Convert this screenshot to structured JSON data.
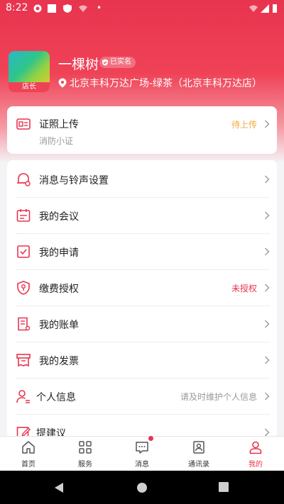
{
  "status_bar": {
    "time": "8:22"
  },
  "profile": {
    "name": "一棵树",
    "verified_label": "已实名",
    "role_badge": "店长",
    "location": "北京丰科万达广场-绿茶（北京丰科万达店）"
  },
  "certificate": {
    "title": "证照上传",
    "subtitle": "消防小证",
    "status": "待上传",
    "status_color": "#f3a83b"
  },
  "menu": [
    {
      "label": "消息与铃声设置",
      "value": ""
    },
    {
      "label": "我的会议",
      "value": ""
    },
    {
      "label": "我的申请",
      "value": ""
    },
    {
      "label": "缴费授权",
      "value": "未授权",
      "value_color": "#e8344f"
    },
    {
      "label": "我的账单",
      "value": ""
    },
    {
      "label": "我的发票",
      "value": ""
    },
    {
      "label": "个人信息",
      "value": "请及时维护个人信息",
      "value_color": "#999999"
    },
    {
      "label": "提建议",
      "value": ""
    }
  ],
  "tabs": [
    {
      "label": "首页",
      "icon": "home-icon",
      "active": false
    },
    {
      "label": "服务",
      "icon": "grid-icon",
      "active": false
    },
    {
      "label": "消息",
      "icon": "chat-icon",
      "active": false,
      "has_dot": true
    },
    {
      "label": "通讯录",
      "icon": "contacts-icon",
      "active": false
    },
    {
      "label": "我的",
      "icon": "person-icon",
      "active": true
    }
  ],
  "colors": {
    "accent": "#e8344f",
    "hero_top": "#e8344f",
    "background": "#f4f4f6"
  }
}
